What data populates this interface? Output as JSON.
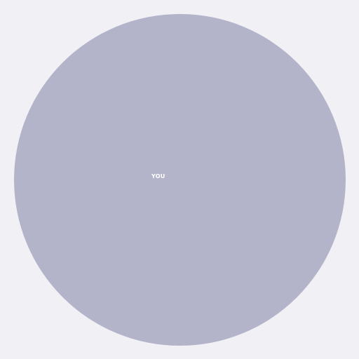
{
  "avatar": {
    "label": "YOU",
    "fill_color": "#b3b4ca",
    "label_color": "#ffffff"
  },
  "page": {
    "background_color": "#f0f0f5"
  }
}
